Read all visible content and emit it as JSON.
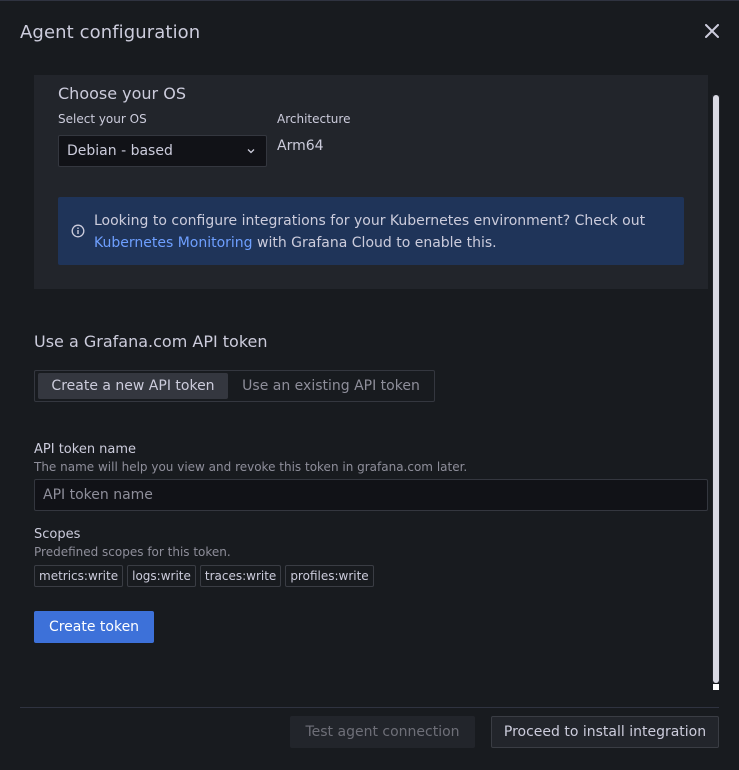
{
  "modal": {
    "title": "Agent configuration",
    "close_icon": "close-icon"
  },
  "os_section": {
    "heading": "Choose your OS",
    "select_label": "Select your OS",
    "select_value": "Debian - based",
    "arch_label": "Architecture",
    "arch_value": "Arm64",
    "alert": {
      "icon": "info-icon",
      "text_before": "Looking to configure integrations for your Kubernetes environment? Check out ",
      "link_text": "Kubernetes Monitoring",
      "text_after": " with Grafana Cloud to enable this."
    }
  },
  "token_section": {
    "heading": "Use a Grafana.com API token",
    "options": [
      "Create a new API token",
      "Use an existing API token"
    ],
    "selected_option": "Create a new API token",
    "name_label": "API token name",
    "name_description": "The name will help you view and revoke this token in grafana.com later.",
    "name_placeholder": "API token name",
    "name_value": "",
    "scopes_label": "Scopes",
    "scopes_description": "Predefined scopes for this token.",
    "scopes": [
      "metrics:write",
      "logs:write",
      "traces:write",
      "profiles:write"
    ],
    "create_button": "Create token"
  },
  "footer": {
    "test_button": "Test agent connection",
    "proceed_button": "Proceed to install integration"
  },
  "colors": {
    "background": "#181b1f",
    "card": "#22252b",
    "primary": "#3d71d9",
    "alert_bg": "#1f3459",
    "link": "#6e9fff"
  }
}
